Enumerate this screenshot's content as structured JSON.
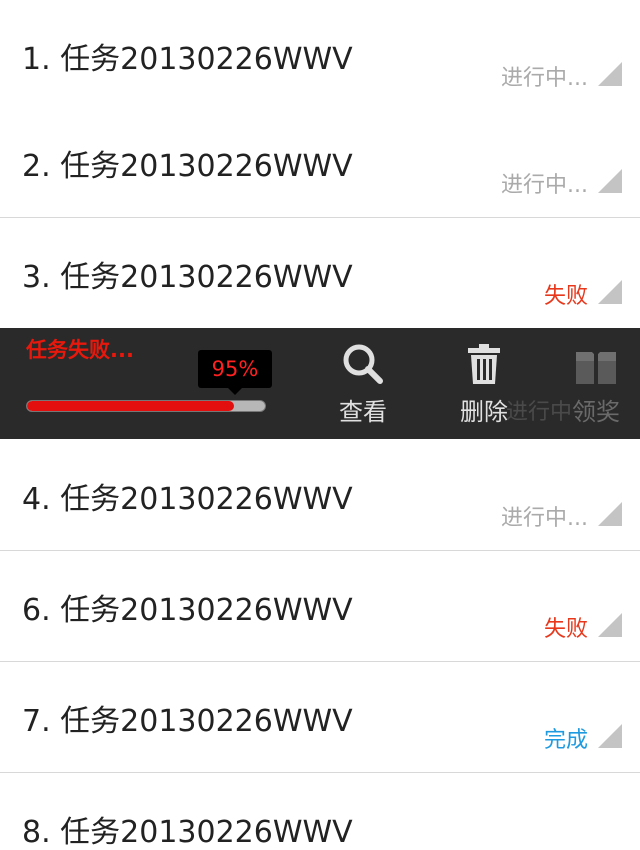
{
  "rows": [
    {
      "title": "1.  任务20130226WWV",
      "status": "进行中...",
      "status_type": "running"
    },
    {
      "title": "2.  任务20130226WWV",
      "status": "进行中...",
      "status_type": "running"
    },
    {
      "title": "3.  任务20130226WWV",
      "status": "失败",
      "status_type": "failed"
    },
    {
      "title": "4.  任务20130226WWV",
      "status": "进行中...",
      "status_type": "running"
    },
    {
      "title": "6.  任务20130226WWV",
      "status": "失败",
      "status_type": "failed"
    },
    {
      "title": "7.  任务20130226WWV",
      "status": "完成",
      "status_type": "done"
    },
    {
      "title": "8.  任务20130226WWV",
      "status": "",
      "status_type": "running"
    }
  ],
  "popup": {
    "fail_text": "任务失败...",
    "progress_label": "95%",
    "progress_fraction": 0.87,
    "behind_text": "进行中",
    "actions": [
      {
        "label": "查看",
        "icon": "search-icon",
        "enabled": true
      },
      {
        "label": "删除",
        "icon": "trash-icon",
        "enabled": true
      },
      {
        "label": "领奖",
        "icon": "gift-icon",
        "enabled": false
      }
    ]
  },
  "colors": {
    "running": "#aaaaaa",
    "failed": "#e8381c",
    "done": "#1e9be0",
    "popup_bg": "#2a2a2a",
    "progress": "#e30f0f"
  }
}
